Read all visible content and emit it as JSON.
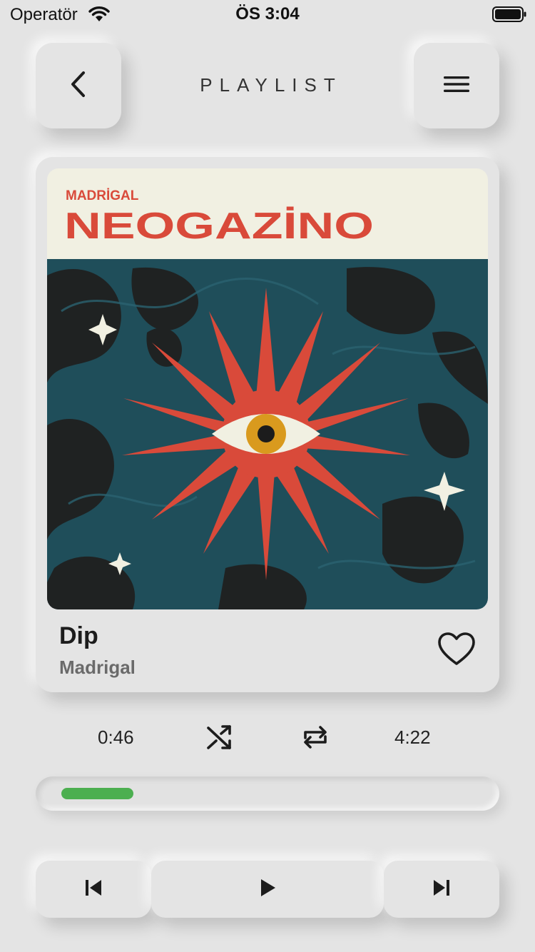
{
  "status_bar": {
    "carrier": "Operatör",
    "time": "ÖS 3:04"
  },
  "header": {
    "title": "PLAYLIST",
    "back_icon": "chevron-left-icon",
    "menu_icon": "hamburger-menu-icon"
  },
  "album": {
    "label_text": "MADRİGAL",
    "logo_text": "NEOGAZİNO"
  },
  "track": {
    "title": "Dip",
    "artist": "Madrigal",
    "favorite_icon": "heart-outline-icon"
  },
  "playback": {
    "elapsed": "0:46",
    "duration": "4:22",
    "progress_fraction": 0.175,
    "shuffle_icon": "shuffle-icon",
    "repeat_icon": "repeat-icon",
    "prev_icon": "skip-previous-icon",
    "play_icon": "play-icon",
    "next_icon": "skip-next-icon"
  },
  "colors": {
    "background": "#e4e4e4",
    "progress": "#4caf50",
    "cover_red": "#d94a3a",
    "cover_teal": "#1f4e5a",
    "cover_cream": "#f1f0e2",
    "eye_iris": "#d99a1e"
  }
}
